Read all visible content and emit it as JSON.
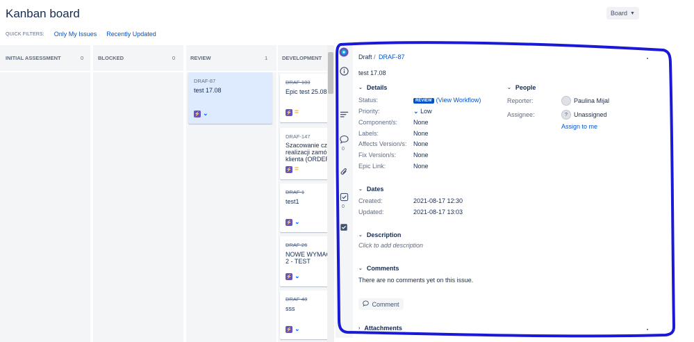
{
  "header": {
    "title": "Kanban board",
    "board_button": "Board"
  },
  "quick_filters": {
    "label": "QUICK FILTERS:",
    "items": [
      "Only My Issues",
      "Recently Updated"
    ]
  },
  "columns": [
    {
      "name": "INITIAL ASSESSMENT",
      "count": "0"
    },
    {
      "name": "BLOCKED",
      "count": "0"
    },
    {
      "name": "REVIEW",
      "count": "1"
    },
    {
      "name": "DEVELOPMENT",
      "count": ""
    }
  ],
  "cards": {
    "review": [
      {
        "key": "DRAF-87",
        "summary": "test 17.08",
        "priority": "low"
      }
    ],
    "development": [
      {
        "key": "DRAF-103",
        "summary": "Epic test 25.08.",
        "priority": "medium",
        "done": true
      },
      {
        "key": "DRAF-147",
        "summary": "Szacowanie cza... realizacji zamów... klienta (ORDER...",
        "summary_lines": [
          "Szacowanie cza",
          "realizacji zamó",
          "klienta (ORDER"
        ],
        "priority": "medium",
        "done": false
      },
      {
        "key": "DRAF-1",
        "summary": "test1",
        "priority": "low",
        "done": true
      },
      {
        "key": "DRAF-26",
        "summary_lines": [
          "NOWE WYMAG",
          "2 - TEST"
        ],
        "priority": "low",
        "done": true
      },
      {
        "key": "DRAF-48",
        "summary": "sss",
        "priority": "low",
        "done": true
      }
    ]
  },
  "detail": {
    "breadcrumb_project": "Draft",
    "breadcrumb_sep": "/",
    "issue_key": "DRAF-87",
    "summary": "test 17.08",
    "sections": {
      "details": "Details",
      "people": "People",
      "dates": "Dates",
      "description": "Description",
      "comments": "Comments",
      "attachments": "Attachments"
    },
    "fields": {
      "status_label": "Status:",
      "status_value": "REVIEW",
      "workflow_link": "(View Workflow)",
      "priority_label": "Priority:",
      "priority_value": "Low",
      "components_label": "Component/s:",
      "components_value": "None",
      "labels_label": "Labels:",
      "labels_value": "None",
      "affects_label": "Affects Version/s:",
      "affects_value": "None",
      "fix_label": "Fix Version/s:",
      "fix_value": "None",
      "epic_label": "Epic Link:",
      "epic_value": "None",
      "reporter_label": "Reporter:",
      "reporter_value": "Paulina Mijal",
      "assignee_label": "Assignee:",
      "assignee_value": "Unassigned",
      "assign_link": "Assign to me",
      "created_label": "Created:",
      "created_value": "2021-08-17 12:30",
      "updated_label": "Updated:",
      "updated_value": "2021-08-17 13:03",
      "description_placeholder": "Click to add description",
      "no_comments": "There are no comments yet on this issue.",
      "comment_button": "Comment"
    },
    "sidebar_counts": {
      "comments": "0",
      "subtasks": "0"
    }
  },
  "colors": {
    "accent": "#0052cc",
    "outline": "#1a1ad6",
    "epic": "#6554c0"
  }
}
